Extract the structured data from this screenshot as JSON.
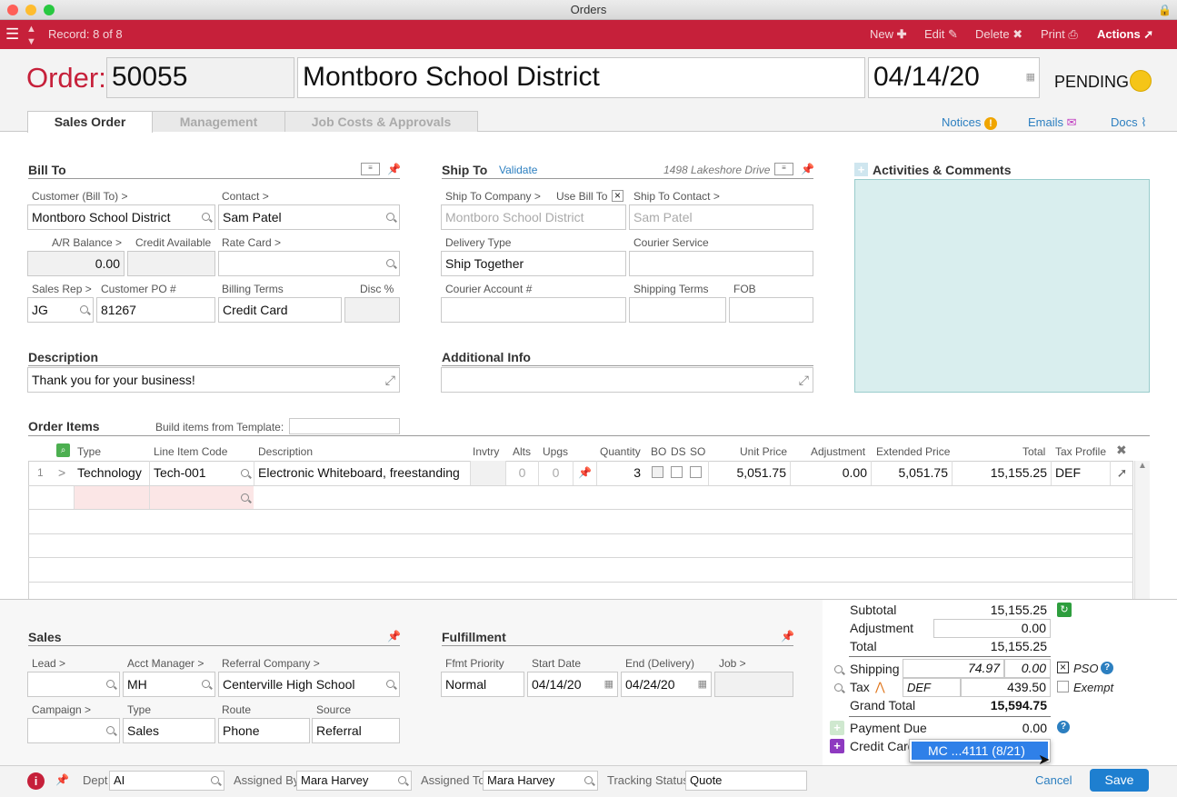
{
  "window": {
    "title": "Orders"
  },
  "toolbar": {
    "record": "Record: 8 of 8",
    "new": "New",
    "edit": "Edit",
    "delete": "Delete",
    "print": "Print",
    "actions": "Actions"
  },
  "order": {
    "label": "Order:",
    "number": "50055",
    "customer": "Montboro School District",
    "date": "04/14/20",
    "status": "PENDING",
    "status_color": "#f5c518"
  },
  "tabs": [
    "Sales Order",
    "Management",
    "Job Costs & Approvals"
  ],
  "header_links": {
    "notices": "Notices",
    "emails": "Emails",
    "docs": "Docs"
  },
  "bill_to": {
    "title": "Bill To",
    "customer_label": "Customer (Bill To) >",
    "customer": "Montboro School District",
    "contact_label": "Contact >",
    "contact": "Sam Patel",
    "ar_label": "A/R Balance >",
    "ar": "0.00",
    "credit_label": "Credit Available",
    "credit": "",
    "ratecard_label": "Rate Card >",
    "ratecard": "",
    "salesrep_label": "Sales Rep >",
    "salesrep": "JG",
    "po_label": "Customer PO #",
    "po": "81267",
    "billing_label": "Billing Terms",
    "billing": "Credit Card",
    "disc_label": "Disc %",
    "disc": ""
  },
  "ship_to": {
    "title": "Ship To",
    "validate": "Validate",
    "address": "1498 Lakeshore Drive",
    "company_label": "Ship To Company >",
    "use_bill_label": "Use Bill To",
    "use_bill_mark": "×",
    "company": "Montboro School District",
    "contact_label": "Ship To Contact >",
    "contact": "Sam Patel",
    "delivery_label": "Delivery Type",
    "delivery": "Ship Together",
    "courier_label": "Courier Service",
    "courier": "",
    "courier_acct_label": "Courier Account #",
    "courier_acct": "",
    "shipping_terms_label": "Shipping Terms",
    "shipping_terms": "",
    "fob_label": "FOB",
    "fob": ""
  },
  "activities": {
    "title": "Activities & Comments"
  },
  "description": {
    "title": "Description",
    "value": "Thank you for your business!"
  },
  "additional": {
    "title": "Additional Info",
    "value": ""
  },
  "order_items": {
    "title": "Order Items",
    "template_label": "Build items from Template:",
    "columns": [
      "Type",
      "Line Item Code",
      "Description",
      "Invtry",
      "Alts",
      "Upgs",
      "Quantity",
      "BO",
      "DS",
      "SO",
      "Unit Price",
      "Adjustment",
      "Extended Price",
      "Total",
      "Tax Profile"
    ],
    "rows": [
      {
        "num": "1",
        "arrow": ">",
        "type": "Technology",
        "code": "Tech-001",
        "description": "Electronic Whiteboard, freestanding",
        "alts": "0",
        "upgs": "0",
        "quantity": "3",
        "unit_price": "5,051.75",
        "adjustment": "0.00",
        "extended": "5,051.75",
        "total": "15,155.25",
        "tax_profile": "DEF"
      }
    ]
  },
  "sales": {
    "title": "Sales",
    "lead_label": "Lead >",
    "lead": "",
    "acct_label": "Acct Manager >",
    "acct": "MH",
    "referral_label": "Referral Company >",
    "referral": "Centerville High School",
    "campaign_label": "Campaign >",
    "campaign": "",
    "type_label": "Type",
    "type": "Sales",
    "route_label": "Route",
    "route": "Phone",
    "source_label": "Source",
    "source": "Referral"
  },
  "fulfillment": {
    "title": "Fulfillment",
    "priority_label": "Ffmt Priority",
    "priority": "Normal",
    "start_label": "Start Date",
    "start": "04/14/20",
    "end_label": "End (Delivery)",
    "end": "04/24/20",
    "job_label": "Job >",
    "job": ""
  },
  "totals": {
    "subtotal_label": "Subtotal",
    "subtotal": "15,155.25",
    "adjustment_label": "Adjustment",
    "adjustment": "0.00",
    "total_label": "Total",
    "total": "15,155.25",
    "shipping_label": "Shipping",
    "shipping_est": "74.97",
    "shipping": "0.00",
    "pso": "PSO",
    "pso_mark": "×",
    "tax_label": "Tax",
    "tax_profile": "DEF",
    "tax": "439.50",
    "exempt": "Exempt",
    "grand_label": "Grand Total",
    "grand": "15,594.75",
    "payment_label": "Payment Due",
    "payment": "0.00",
    "cc_label": "Credit Card",
    "cc_option": "MC ...4111 (8/21)"
  },
  "footer": {
    "dept_label": "Dept",
    "dept": "AI",
    "assigned_by_label": "Assigned By",
    "assigned_by": "Mara Harvey",
    "assigned_to_label": "Assigned To",
    "assigned_to": "Mara Harvey",
    "tracking_label": "Tracking Status",
    "tracking": "Quote",
    "cancel": "Cancel",
    "save": "Save"
  }
}
